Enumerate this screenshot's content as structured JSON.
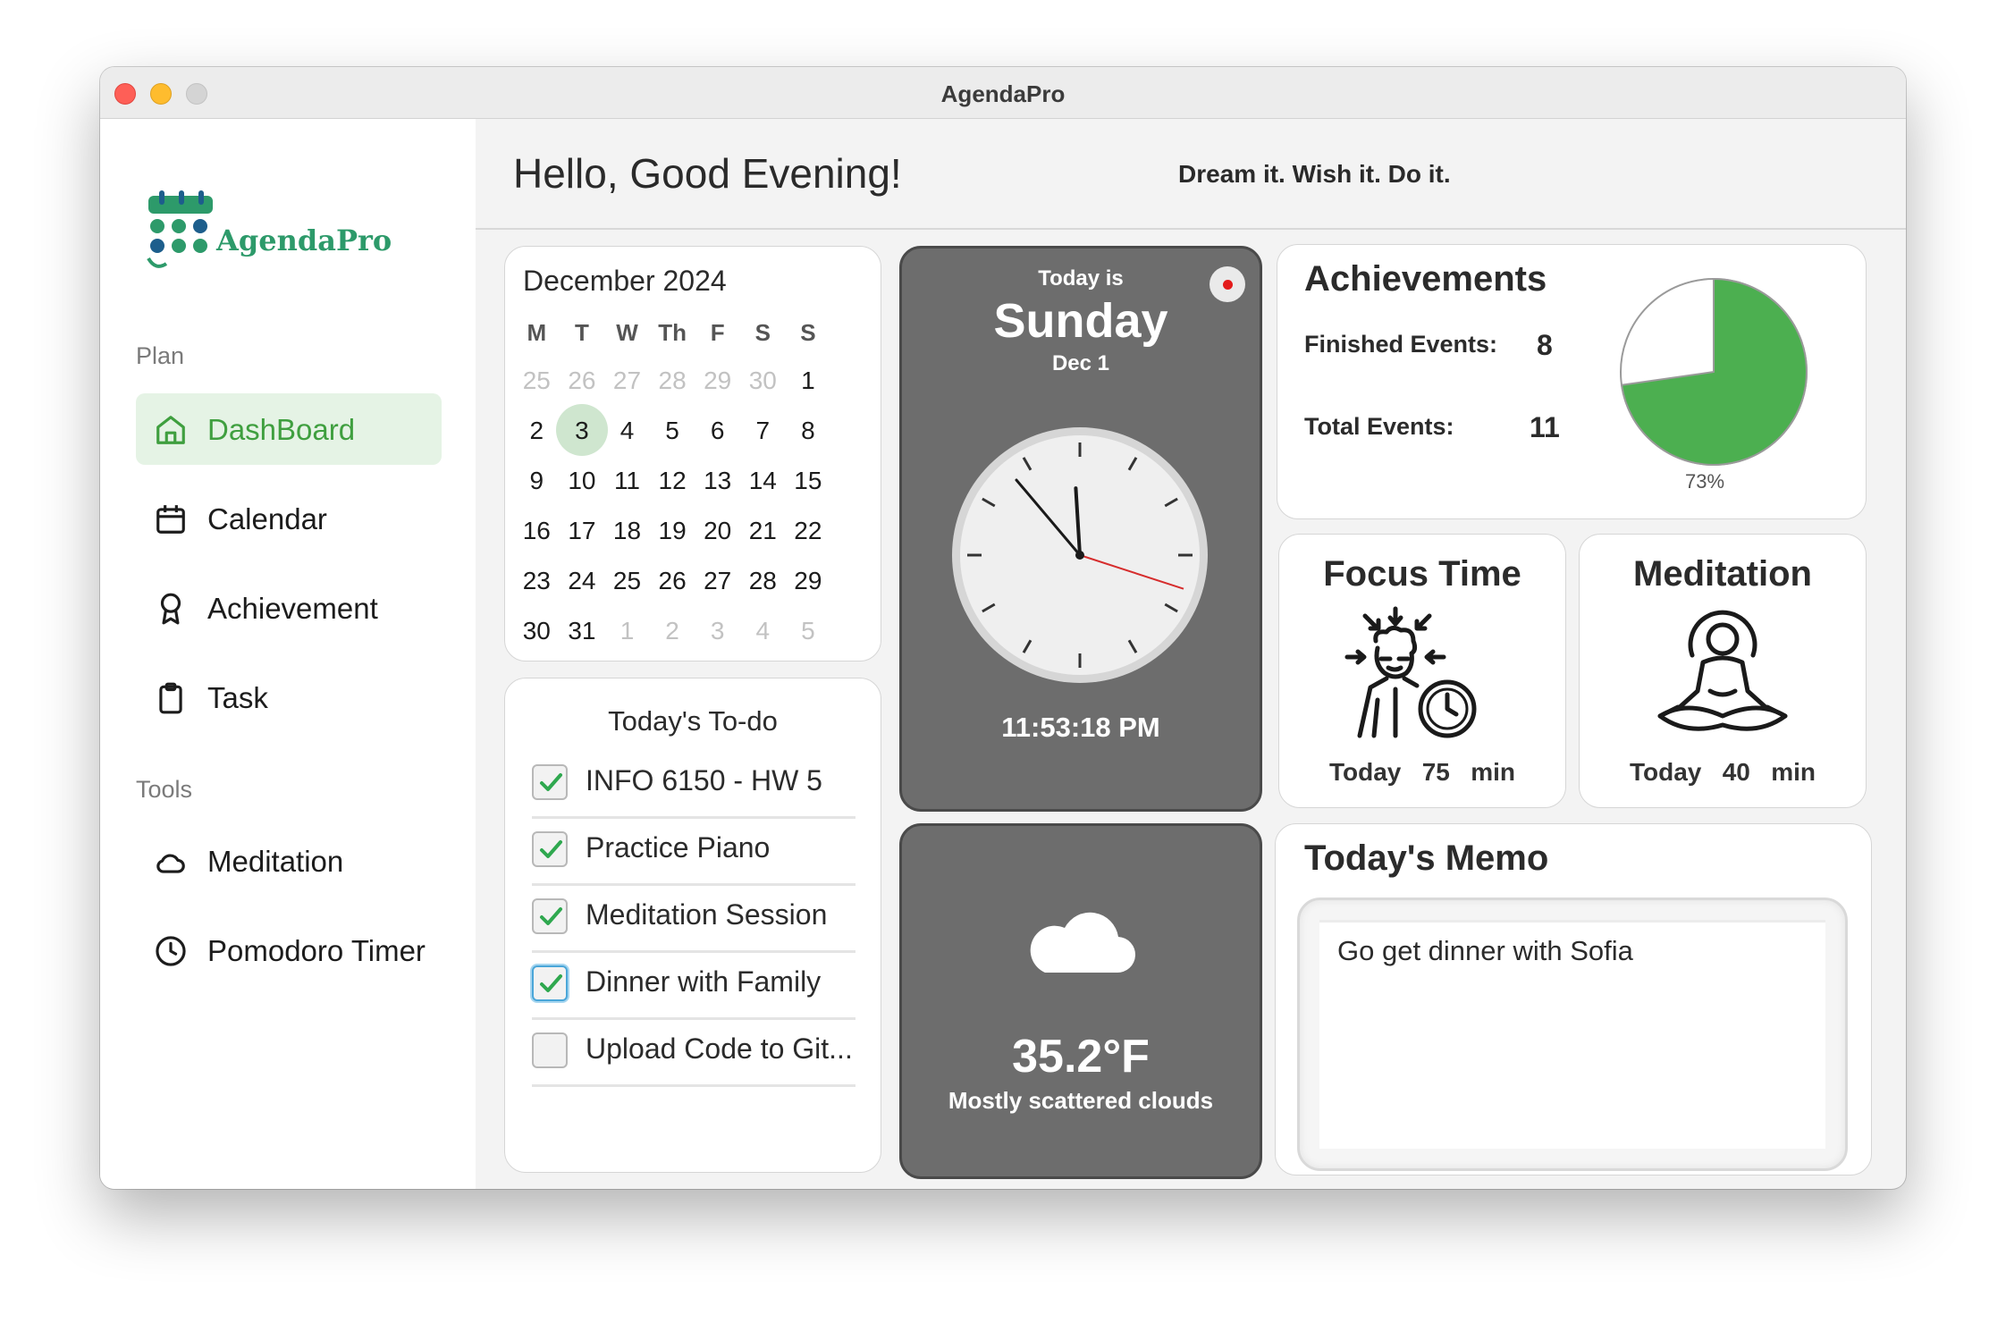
{
  "window": {
    "title": "AgendaPro"
  },
  "sidebar": {
    "logo_text": "AgendaPro",
    "section_plan": "Plan",
    "section_tools": "Tools",
    "items": [
      {
        "label": "DashBoard",
        "icon": "home-icon",
        "active": true
      },
      {
        "label": "Calendar",
        "icon": "calendar-icon",
        "active": false
      },
      {
        "label": "Achievement",
        "icon": "award-icon",
        "active": false
      },
      {
        "label": "Task",
        "icon": "clipboard-icon",
        "active": false
      },
      {
        "label": "Meditation",
        "icon": "cloud-icon",
        "active": false
      },
      {
        "label": "Pomodoro Timer",
        "icon": "clock-icon",
        "active": false
      }
    ]
  },
  "header": {
    "greeting": "Hello, Good Evening!",
    "motto": "Dream it. Wish it. Do it."
  },
  "calendar": {
    "title": "December 2024",
    "weekdays": [
      "M",
      "T",
      "W",
      "Th",
      "F",
      "S",
      "S"
    ],
    "weeks": [
      [
        "25",
        "26",
        "27",
        "28",
        "29",
        "30",
        "1"
      ],
      [
        "2",
        "3",
        "4",
        "5",
        "6",
        "7",
        "8"
      ],
      [
        "9",
        "10",
        "11",
        "12",
        "13",
        "14",
        "15"
      ],
      [
        "16",
        "17",
        "18",
        "19",
        "20",
        "21",
        "22"
      ],
      [
        "23",
        "24",
        "25",
        "26",
        "27",
        "28",
        "29"
      ],
      [
        "30",
        "31",
        "1",
        "2",
        "3",
        "4",
        "5"
      ]
    ],
    "muted": [
      [
        0,
        0
      ],
      [
        0,
        1
      ],
      [
        0,
        2
      ],
      [
        0,
        3
      ],
      [
        0,
        4
      ],
      [
        0,
        5
      ],
      [
        5,
        2
      ],
      [
        5,
        3
      ],
      [
        5,
        4
      ],
      [
        5,
        5
      ],
      [
        5,
        6
      ]
    ],
    "highlight": [
      1,
      1
    ],
    "highlight_color": "#cfe6cf"
  },
  "todo": {
    "title": "Today's To-do",
    "items": [
      {
        "label": "INFO 6150 - HW 5",
        "checked": true
      },
      {
        "label": "Practice Piano",
        "checked": true
      },
      {
        "label": "Meditation Session",
        "checked": true
      },
      {
        "label": "Dinner with Family",
        "checked": true
      },
      {
        "label": "Upload Code to Git...",
        "checked": false
      }
    ]
  },
  "clock": {
    "today_is": "Today is",
    "day": "Sunday",
    "date": "Dec 1",
    "time": "11:53:18 PM",
    "hour": 23,
    "minute": 53,
    "second": 18
  },
  "weather": {
    "icon": "cloud-icon",
    "temperature": "35.2°F",
    "description": "Mostly scattered clouds"
  },
  "achievements": {
    "title": "Achievements",
    "finished_label": "Finished Events:",
    "finished_value": "8",
    "total_label": "Total Events:",
    "total_value": "11",
    "percent_label": "73%",
    "fraction": 0.7273,
    "accent": "#4caf50"
  },
  "focus": {
    "title": "Focus Time",
    "footer_label": "Today",
    "minutes": "75",
    "unit": "min"
  },
  "meditation": {
    "title": "Meditation",
    "footer_label": "Today",
    "minutes": "40",
    "unit": "min"
  },
  "memo": {
    "title": "Today's Memo",
    "text": "Go get dinner with Sofia"
  }
}
